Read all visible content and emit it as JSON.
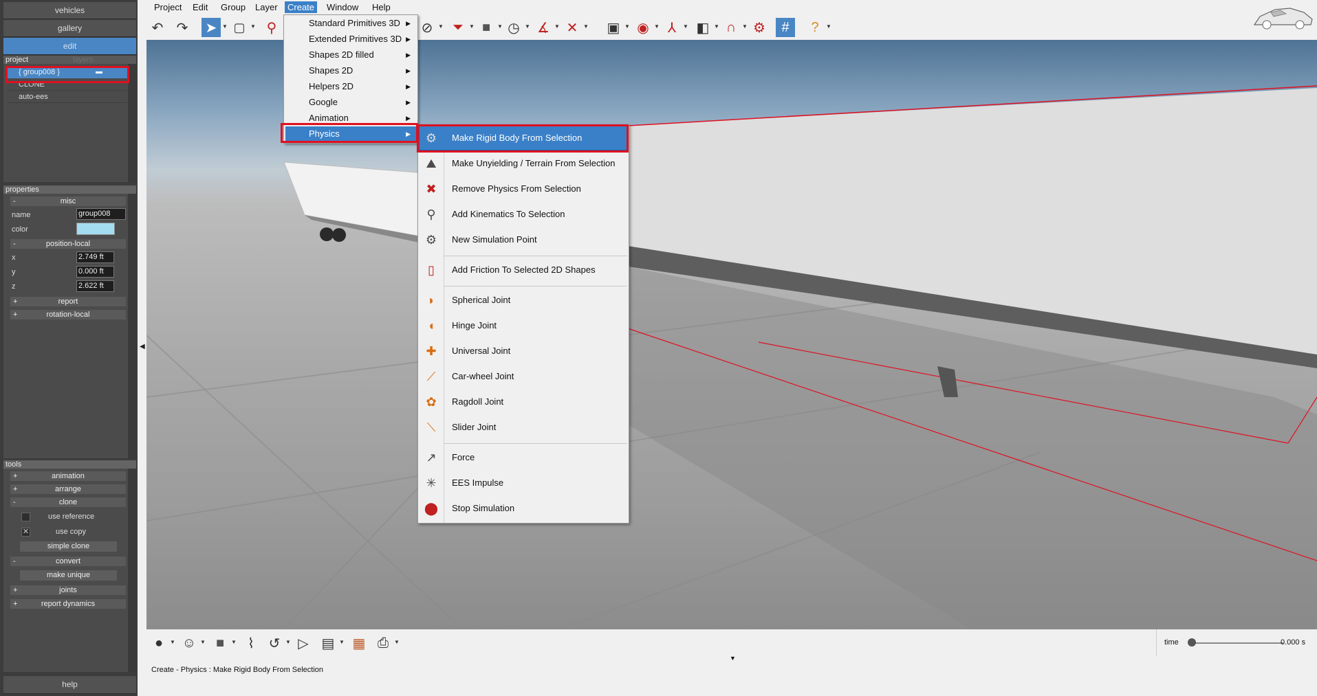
{
  "left_panel": {
    "vehicles": "vehicles",
    "gallery": "gallery",
    "edit": "edit",
    "tab_project": "project",
    "tab_layers": "layers",
    "tree": [
      {
        "label": "{ group008 }",
        "selected": true
      },
      {
        "label": "CLONE",
        "selected": false
      },
      {
        "label": "auto-ees",
        "selected": false
      }
    ],
    "properties_title": "properties",
    "misc": {
      "sign": "-",
      "label": "misc"
    },
    "name_label": "name",
    "name_value": "group008",
    "color_label": "color",
    "color_value": "#a4dcf2",
    "position_local": {
      "sign": "-",
      "label": "position-local"
    },
    "x_label": "x",
    "x_value": "2.749 ft",
    "y_label": "y",
    "y_value": "0.000 ft",
    "z_label": "z",
    "z_value": "2.622 ft",
    "report": {
      "sign": "+",
      "label": "report"
    },
    "rotation_local": {
      "sign": "+",
      "label": "rotation-local"
    },
    "tools_title": "tools",
    "animation": {
      "sign": "+",
      "label": "animation"
    },
    "arrange": {
      "sign": "+",
      "label": "arrange"
    },
    "clone": {
      "sign": "-",
      "label": "clone"
    },
    "use_reference": "use reference",
    "use_copy": "use copy",
    "use_copy_mark": "✕",
    "simple_clone": "simple clone",
    "convert": {
      "sign": "-",
      "label": "convert"
    },
    "make_unique": "make unique",
    "joints": {
      "sign": "+",
      "label": "joints"
    },
    "report_dynamics": {
      "sign": "+",
      "label": "report dynamics"
    },
    "help": "help"
  },
  "menubar": [
    "Project",
    "Edit",
    "Group",
    "Layer",
    "Create",
    "Window",
    "Help"
  ],
  "create_menu": [
    "Standard Primitives 3D",
    "Extended Primitives 3D",
    "Shapes 2D filled",
    "Shapes 2D",
    "Helpers 2D",
    "Google",
    "Animation",
    "Physics"
  ],
  "physics_menu": [
    {
      "label": "Make Rigid Body From Selection",
      "icon": "rigid-body-gears-icon"
    },
    {
      "label": "Make Unyielding / Terrain From Selection",
      "icon": "terrain-icon"
    },
    {
      "label": "Remove Physics From Selection",
      "icon": "remove-physics-icon"
    },
    {
      "label": "Add Kinematics To Selection",
      "icon": "kinematics-icon"
    },
    {
      "label": "New Simulation Point",
      "icon": "simulation-point-icon"
    },
    {
      "label": "Add Friction To Selected 2D Shapes",
      "icon": "friction-icon"
    },
    {
      "label": "Spherical Joint",
      "icon": "spherical-joint-icon"
    },
    {
      "label": "Hinge Joint",
      "icon": "hinge-joint-icon"
    },
    {
      "label": "Universal Joint",
      "icon": "universal-joint-icon"
    },
    {
      "label": "Car-wheel Joint",
      "icon": "car-wheel-joint-icon"
    },
    {
      "label": "Ragdoll Joint",
      "icon": "ragdoll-joint-icon"
    },
    {
      "label": "Slider Joint",
      "icon": "slider-joint-icon"
    },
    {
      "label": "Force",
      "icon": "force-icon"
    },
    {
      "label": "EES Impulse",
      "icon": "impulse-icon"
    },
    {
      "label": "Stop Simulation",
      "icon": "stop-simulation-icon"
    }
  ],
  "status": {
    "breadcrumb": "Create - Physics : Make Rigid Body From Selection",
    "time_label": "time",
    "time_value": "0.000 s"
  },
  "colors": {
    "accent": "#3a80c8",
    "highlight_frame": "#e01020",
    "selection_edge": "#e01020"
  }
}
